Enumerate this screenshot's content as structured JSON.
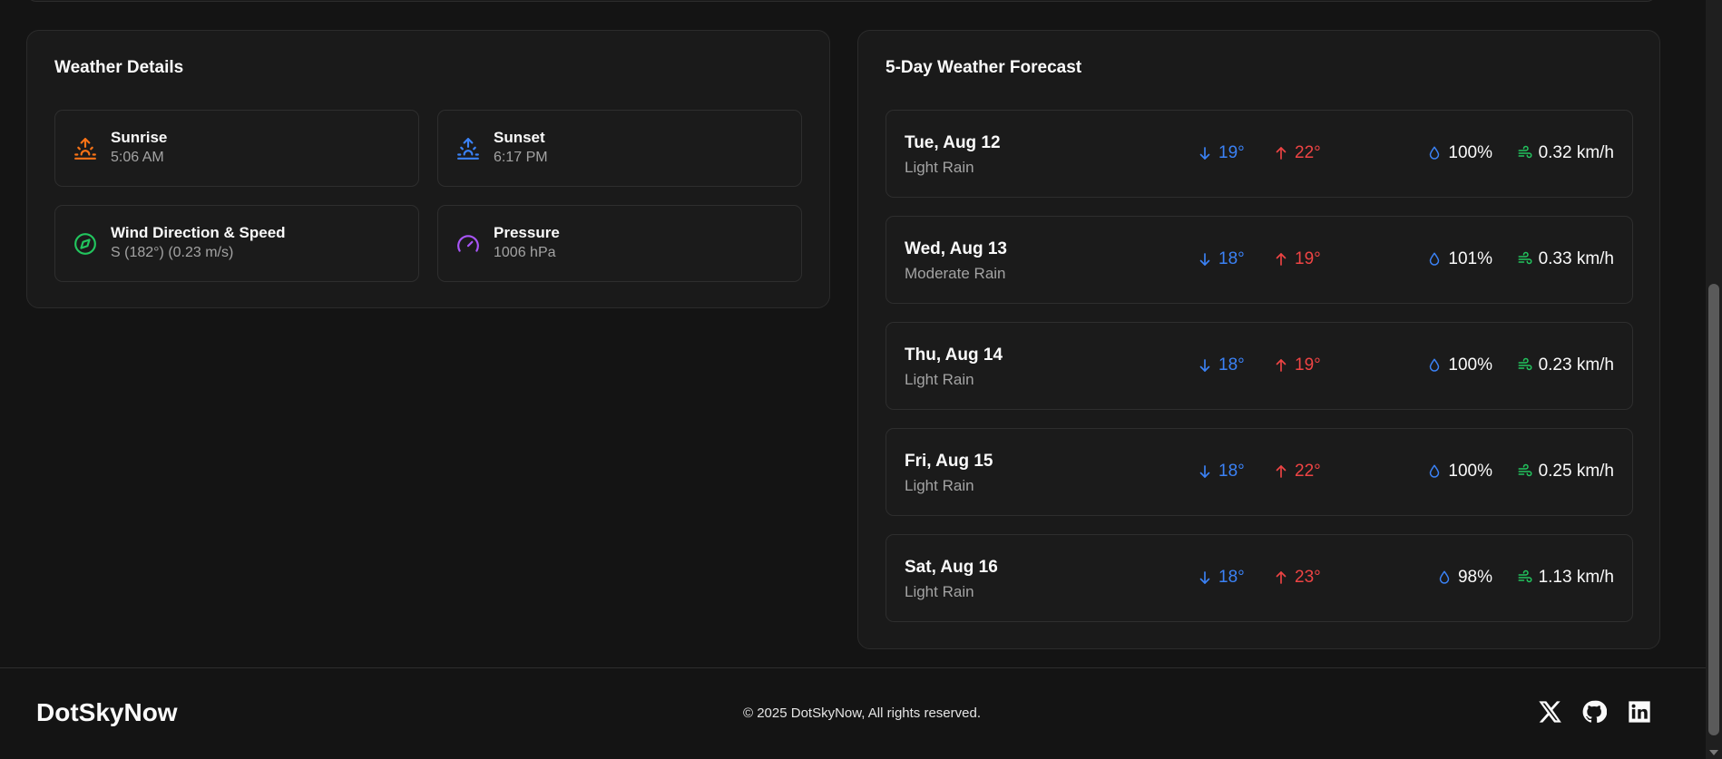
{
  "details": {
    "title": "Weather Details",
    "cards": [
      {
        "label": "Sunrise",
        "value": "5:06 AM",
        "icon": "sunrise-icon",
        "color": "#f97316"
      },
      {
        "label": "Sunset",
        "value": "6:17 PM",
        "icon": "sunset-icon",
        "color": "#3b82f6"
      },
      {
        "label": "Wind Direction & Speed",
        "value": "S (182°) (0.23 m/s)",
        "icon": "compass-icon",
        "color": "#22c55e"
      },
      {
        "label": "Pressure",
        "value": "1006 hPa",
        "icon": "gauge-icon",
        "color": "#a855f7"
      }
    ]
  },
  "forecast": {
    "title": "5-Day Weather Forecast",
    "days": [
      {
        "date": "Tue, Aug 12",
        "condition": "Light Rain",
        "low": "19°",
        "high": "22°",
        "humidity": "100%",
        "wind": "0.32 km/h"
      },
      {
        "date": "Wed, Aug 13",
        "condition": "Moderate Rain",
        "low": "18°",
        "high": "19°",
        "humidity": "101%",
        "wind": "0.33 km/h"
      },
      {
        "date": "Thu, Aug 14",
        "condition": "Light Rain",
        "low": "18°",
        "high": "19°",
        "humidity": "100%",
        "wind": "0.23 km/h"
      },
      {
        "date": "Fri, Aug 15",
        "condition": "Light Rain",
        "low": "18°",
        "high": "22°",
        "humidity": "100%",
        "wind": "0.25 km/h"
      },
      {
        "date": "Sat, Aug 16",
        "condition": "Light Rain",
        "low": "18°",
        "high": "23°",
        "humidity": "98%",
        "wind": "1.13 km/h"
      }
    ]
  },
  "footer": {
    "brand": "DotSkyNow",
    "copyright": "© 2025 DotSkyNow, All rights reserved.",
    "social": [
      "x-icon",
      "github-icon",
      "linkedin-icon"
    ]
  },
  "colors": {
    "low": "#3b82f6",
    "high": "#ef4444",
    "humidity": "#3b82f6",
    "wind": "#22c55e"
  }
}
